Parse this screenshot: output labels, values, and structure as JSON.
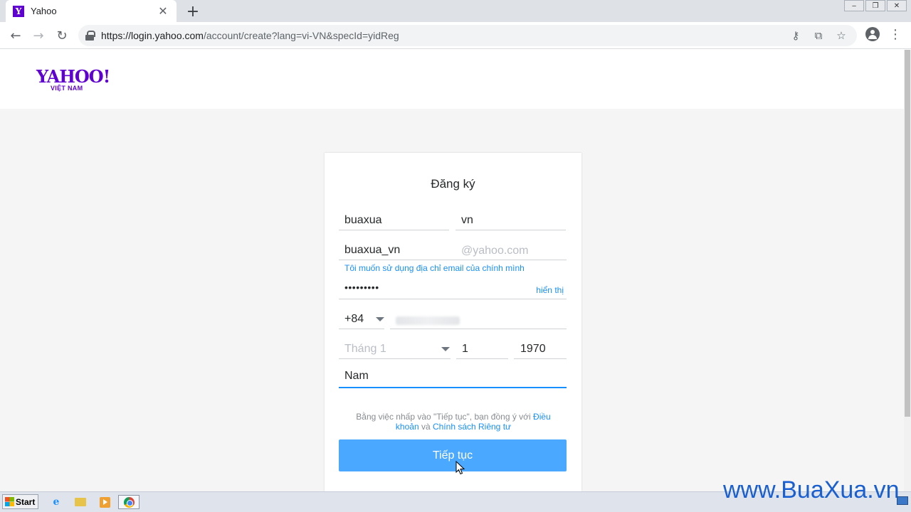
{
  "browser": {
    "tab_title": "Yahoo",
    "tab_favicon": "Y",
    "url_host": "https://login.yahoo.com",
    "url_rest": "/account/create?lang=vi-VN&specId=yidReg"
  },
  "logo": {
    "main": "YAHOO!",
    "sub": "VIỆT NAM"
  },
  "form": {
    "title": "Đăng ký",
    "first_name": "buaxua",
    "last_name": "vn",
    "email_user": "buaxua_vn",
    "email_domain_placeholder": "@yahoo.com",
    "own_email_link": "Tôi muốn sử dụng địa chỉ email của chính mình",
    "password_masked": "•••••••••",
    "show_password_label": "hiển thị",
    "country_code": "+84",
    "birth_month_placeholder": "Tháng 1",
    "birth_day": "1",
    "birth_year": "1970",
    "gender": "Nam",
    "terms_prefix": "Bằng việc nhấp vào \"Tiếp tục\", bạn đồng ý với ",
    "terms_link": "Điều khoản",
    "terms_and": " và ",
    "privacy_link": "Chính sách Riêng tư",
    "submit_label": "Tiếp tục"
  },
  "taskbar": {
    "start_label": "Start"
  },
  "watermark": "www.BuaXua.vn",
  "colors": {
    "yahoo_purple": "#5f01d1",
    "link_blue": "#188fff",
    "button_blue": "#4aa8ff"
  }
}
